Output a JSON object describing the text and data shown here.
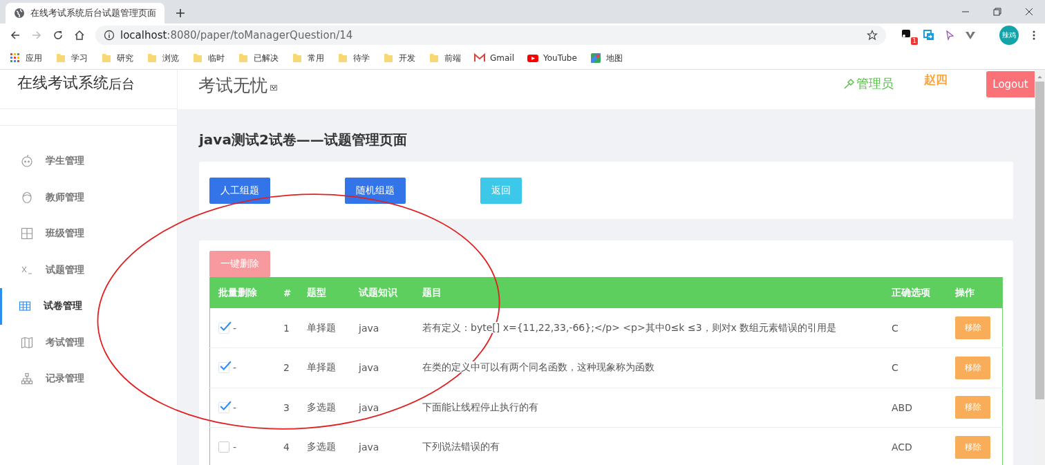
{
  "browser": {
    "tab_title": "在线考试系统后台试题管理页面",
    "url_host": "localhost",
    "url_path": ":8080/paper/toManagerQuestion/14",
    "extension_badge": "1",
    "profile": "辣鸡",
    "bookmarks": [
      {
        "label": "应用",
        "kind": "apps"
      },
      {
        "label": "学习",
        "kind": "folder"
      },
      {
        "label": "研究",
        "kind": "folder"
      },
      {
        "label": "浏览",
        "kind": "folder"
      },
      {
        "label": "临时",
        "kind": "folder"
      },
      {
        "label": "已解决",
        "kind": "folder"
      },
      {
        "label": "常用",
        "kind": "folder"
      },
      {
        "label": "待学",
        "kind": "folder"
      },
      {
        "label": "开发",
        "kind": "folder"
      },
      {
        "label": "前端",
        "kind": "folder"
      },
      {
        "label": "Gmail",
        "kind": "mail"
      },
      {
        "label": "YouTube",
        "kind": "video"
      },
      {
        "label": "地图",
        "kind": "map"
      }
    ]
  },
  "sidebar": {
    "title": "在线考试系统",
    "title_suffix": "后台",
    "items": [
      {
        "label": "学生管理",
        "kind": "face",
        "selected": false
      },
      {
        "label": "教师管理",
        "kind": "head",
        "selected": false
      },
      {
        "label": "班级管理",
        "kind": "grid",
        "selected": false
      },
      {
        "label": "试题管理",
        "kind": "formula",
        "selected": false
      },
      {
        "label": "试卷管理",
        "kind": "table",
        "selected": true
      },
      {
        "label": "考试管理",
        "kind": "map",
        "selected": false
      },
      {
        "label": "记录管理",
        "kind": "tree",
        "selected": false
      }
    ]
  },
  "header": {
    "brand": "考试无忧",
    "role": "管理员",
    "user": "赵四",
    "logout": "Logout"
  },
  "page_title": "java测试2试卷——试题管理页面",
  "actions": [
    {
      "label": "人工组题",
      "kind": "primary"
    },
    {
      "label": "随机组题",
      "kind": "primary"
    },
    {
      "label": "返回",
      "kind": "info"
    }
  ],
  "bulk_delete": "一键删除",
  "table": {
    "columns": [
      "批量删除",
      "#",
      "题型",
      "试题知识",
      "题目",
      "正确选项",
      "操作"
    ],
    "rows": [
      {
        "checked": true,
        "mark": "-",
        "number": "1",
        "type": "单择题",
        "knowledge": "java",
        "question": "若有定义：byte[] x={11,22,33,-66};</p> <p>其中0≤k ≤3，则对x 数组元素错误的引用是",
        "answer": "C",
        "action": "移除"
      },
      {
        "checked": true,
        "mark": "-",
        "number": "2",
        "type": "单择题",
        "knowledge": "java",
        "question": "在类的定义中可以有两个同名函数，这种现象称为函数",
        "answer": "C",
        "action": "移除"
      },
      {
        "checked": true,
        "mark": "-",
        "number": "3",
        "type": "多选题",
        "knowledge": "java",
        "question": "下面能让线程停止执行的有",
        "answer": "ABD",
        "action": "移除"
      },
      {
        "checked": false,
        "mark": "-",
        "number": "4",
        "type": "多选题",
        "knowledge": "java",
        "question": "下列说法错误的有",
        "answer": "ACD",
        "action": "移除"
      }
    ]
  }
}
